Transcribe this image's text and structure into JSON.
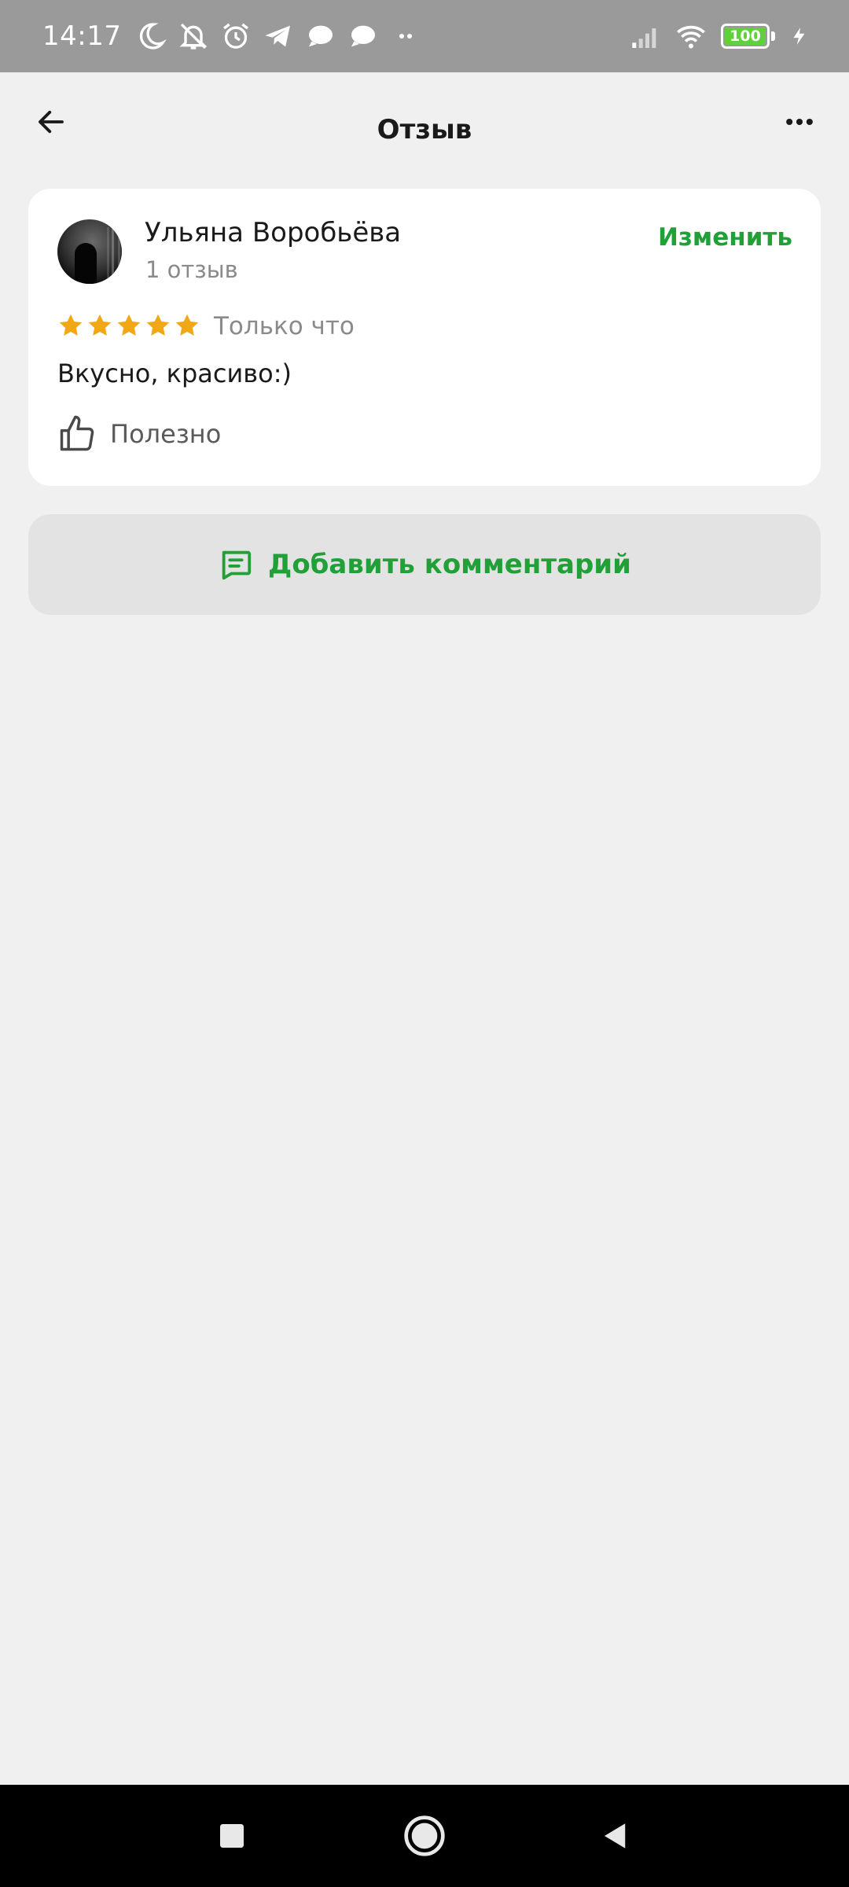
{
  "status_bar": {
    "time": "14:17",
    "battery_level": "100",
    "icons": [
      "moon-icon",
      "bell-off-icon",
      "alarm-icon",
      "telegram-icon",
      "chat-bubble-icon",
      "chat-bubble-icon",
      "more-dots-icon",
      "signal-icon",
      "wifi-icon",
      "battery-icon",
      "charging-icon"
    ]
  },
  "header": {
    "title": "Отзыв",
    "back_icon": "arrow-left-icon",
    "menu_icon": "more-horizontal-icon"
  },
  "review": {
    "author_name": "Ульяна Воробьёва",
    "author_reviews_count": "1 отзыв",
    "edit_label": "Изменить",
    "rating": 5,
    "rating_max": 5,
    "time": "Только что",
    "text": "Вкусно, красиво:)",
    "useful_label": "Полезно"
  },
  "actions": {
    "add_comment_label": "Добавить комментарий",
    "add_comment_icon": "comment-icon"
  },
  "colors": {
    "accent_green": "#21a038",
    "star_color": "#f2a714",
    "status_bar_bg": "#9a9a9a",
    "page_bg": "#f0f0f0"
  },
  "nav_bar": {
    "buttons": [
      "recents-button",
      "home-button",
      "back-button"
    ]
  }
}
